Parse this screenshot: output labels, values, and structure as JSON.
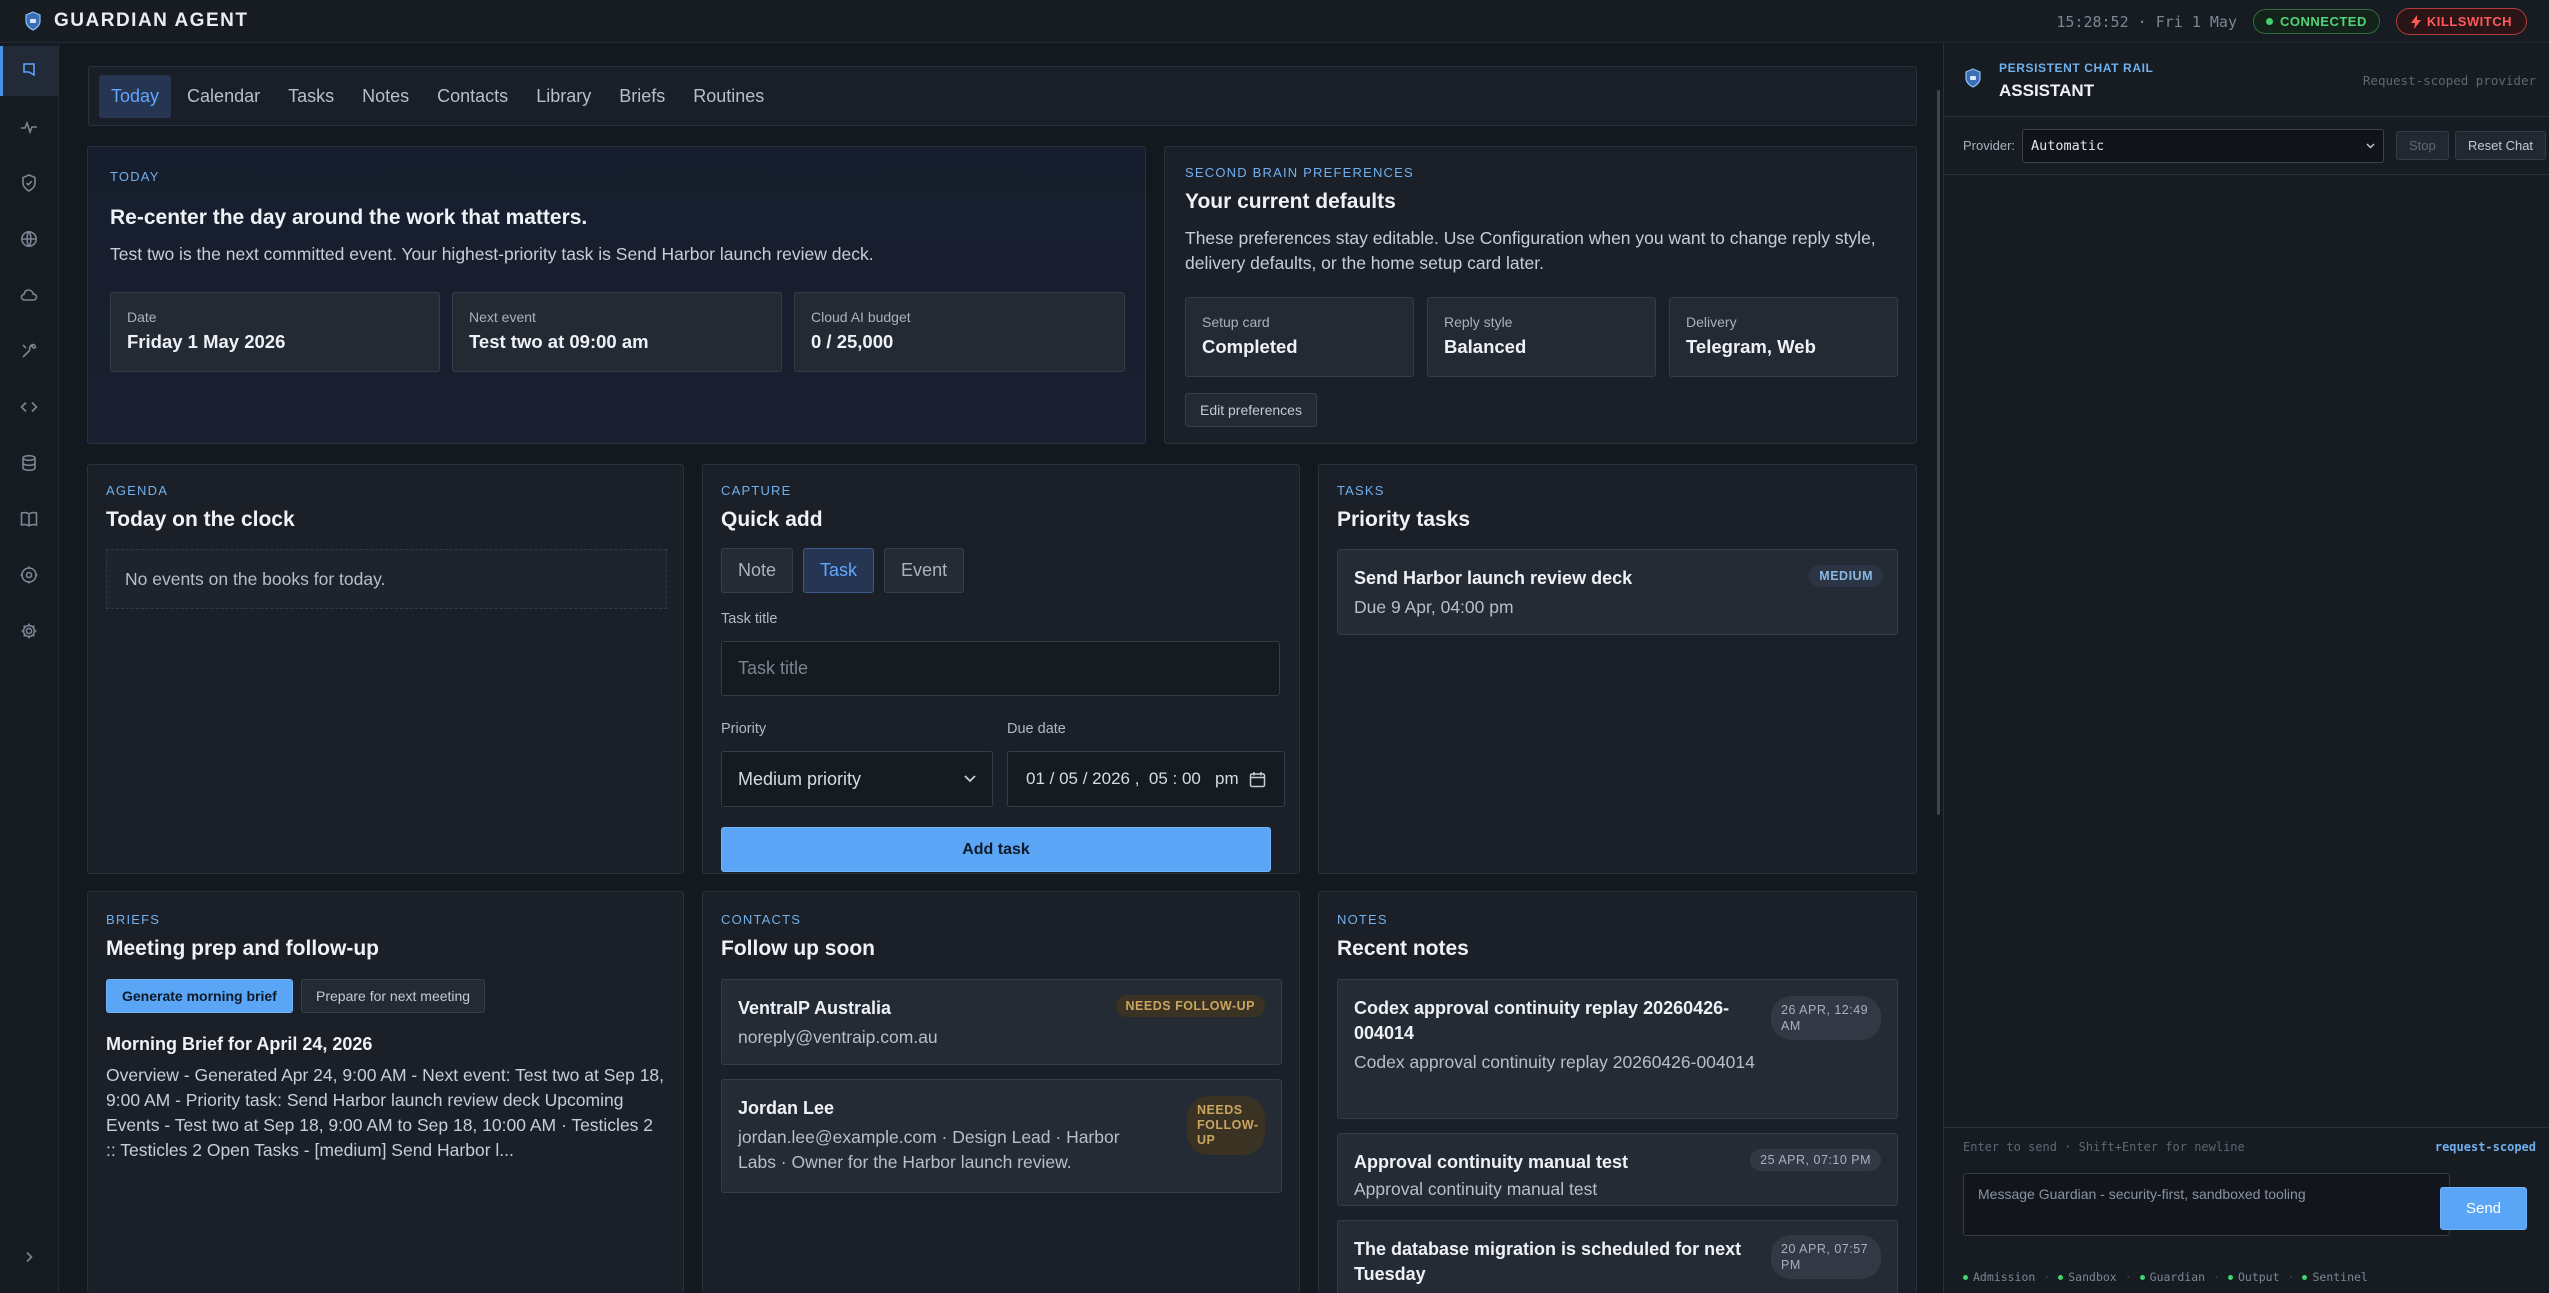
{
  "app": {
    "title": "GUARDIAN AGENT",
    "clock": "15:28:52 · Fri 1 May",
    "status": "CONNECTED",
    "killswitch": "KILLSWITCH"
  },
  "tabs": [
    "Today",
    "Calendar",
    "Tasks",
    "Notes",
    "Contacts",
    "Library",
    "Briefs",
    "Routines"
  ],
  "today": {
    "eyebrow": "TODAY",
    "title": "Re-center the day around the work that matters.",
    "summary": "Test two is the next committed event. Your highest-priority task is Send Harbor launch review deck.",
    "stats": [
      {
        "label": "Date",
        "value": "Friday 1 May 2026"
      },
      {
        "label": "Next event",
        "value": "Test two at 09:00 am"
      },
      {
        "label": "Cloud AI budget",
        "value": "0 / 25,000"
      }
    ]
  },
  "preferences": {
    "eyebrow": "SECOND BRAIN PREFERENCES",
    "title": "Your current defaults",
    "text": "These preferences stay editable. Use Configuration when you want to change reply style, delivery defaults, or the home setup card later.",
    "stats": [
      {
        "label": "Setup card",
        "value": "Completed"
      },
      {
        "label": "Reply style",
        "value": "Balanced"
      },
      {
        "label": "Delivery",
        "value": "Telegram, Web"
      }
    ],
    "edit_button": "Edit preferences"
  },
  "agenda": {
    "eyebrow": "AGENDA",
    "title": "Today on the clock",
    "empty": "No events on the books for today."
  },
  "capture": {
    "eyebrow": "CAPTURE",
    "title": "Quick add",
    "modes": [
      "Note",
      "Task",
      "Event"
    ],
    "task_title_label": "Task title",
    "task_title_placeholder": "Task title",
    "priority_label": "Priority",
    "priority_value": "Medium priority",
    "due_label": "Due date",
    "due_value": "01 / 05 / 2026 ,  05 : 00   pm",
    "add_button": "Add task"
  },
  "tasks": {
    "eyebrow": "TASKS",
    "title": "Priority tasks",
    "items": [
      {
        "title": "Send Harbor launch review deck",
        "due": "Due 9 Apr, 04:00 pm",
        "badge": "MEDIUM"
      }
    ]
  },
  "briefs": {
    "eyebrow": "BRIEFS",
    "title": "Meeting prep and follow-up",
    "generate_button": "Generate morning brief",
    "prepare_button": "Prepare for next meeting",
    "brief_title": "Morning Brief for April 24, 2026",
    "brief_text": "Overview - Generated Apr 24, 9:00 AM - Next event: Test two at Sep 18, 9:00 AM - Priority task: Send Harbor launch review deck Upcoming Events - Test two at Sep 18, 9:00 AM to Sep 18, 10:00 AM · Testicles 2 :: Testicles 2 Open Tasks - [medium] Send Harbor l..."
  },
  "contacts": {
    "eyebrow": "CONTACTS",
    "title": "Follow up soon",
    "items": [
      {
        "name": "VentraIP Australia",
        "detail": "noreply@ventraip.com.au",
        "badge": "NEEDS FOLLOW-UP"
      },
      {
        "name": "Jordan Lee",
        "detail": "jordan.lee@example.com · Design Lead · Harbor Labs · Owner for the Harbor launch review.",
        "badge": "NEEDS FOLLOW-UP"
      }
    ]
  },
  "notes": {
    "eyebrow": "NOTES",
    "title": "Recent notes",
    "items": [
      {
        "title": "Codex approval continuity replay 20260426-004014",
        "body": "Codex approval continuity replay 20260426-004014",
        "date": "26 APR, 12:49 AM"
      },
      {
        "title": "Approval continuity manual test",
        "body": "Approval continuity manual test",
        "date": "25 APR, 07:10 PM"
      },
      {
        "title": "The database migration is scheduled for next Tuesday",
        "body": "",
        "date": "20 APR, 07:57 PM"
      }
    ]
  },
  "chat": {
    "eyebrow": "PERSISTENT CHAT RAIL",
    "title": "ASSISTANT",
    "scope": "Request-scoped provider",
    "provider_label": "Provider:",
    "provider_value": "Automatic",
    "stop_button": "Stop",
    "reset_button": "Reset Chat",
    "hint": "Enter to send · Shift+Enter for newline",
    "scope_tag": "request-scoped",
    "placeholder": "Message Guardian - security-first, sandboxed tooling",
    "send_button": "Send",
    "statuses": [
      "Admission",
      "Sandbox",
      "Guardian",
      "Output",
      "Sentinel"
    ]
  },
  "colors": {
    "accent": "#5aa5f5",
    "connected": "#3fd26d",
    "danger": "#ff5959",
    "background": "#14181f"
  },
  "icons": [
    "chat-icon",
    "activity-icon",
    "shield-icon",
    "globe-icon",
    "cloud-icon",
    "tools-icon",
    "code-icon",
    "database-icon",
    "book-icon",
    "target-icon",
    "gear-icon",
    "expand-icon"
  ]
}
